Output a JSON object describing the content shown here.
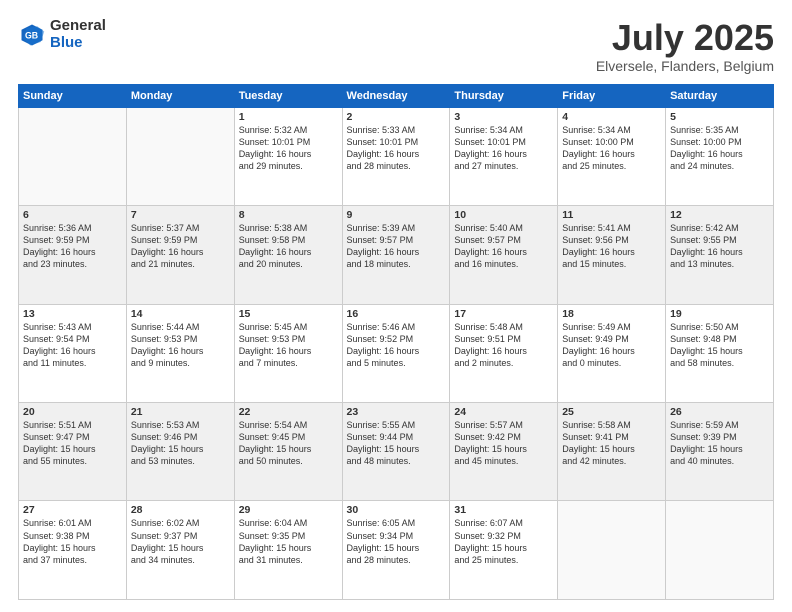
{
  "logo": {
    "general": "General",
    "blue": "Blue"
  },
  "header": {
    "month": "July 2025",
    "location": "Elversele, Flanders, Belgium"
  },
  "days_of_week": [
    "Sunday",
    "Monday",
    "Tuesday",
    "Wednesday",
    "Thursday",
    "Friday",
    "Saturday"
  ],
  "weeks": [
    [
      {
        "num": "",
        "info": ""
      },
      {
        "num": "",
        "info": ""
      },
      {
        "num": "1",
        "info": "Sunrise: 5:32 AM\nSunset: 10:01 PM\nDaylight: 16 hours\nand 29 minutes."
      },
      {
        "num": "2",
        "info": "Sunrise: 5:33 AM\nSunset: 10:01 PM\nDaylight: 16 hours\nand 28 minutes."
      },
      {
        "num": "3",
        "info": "Sunrise: 5:34 AM\nSunset: 10:01 PM\nDaylight: 16 hours\nand 27 minutes."
      },
      {
        "num": "4",
        "info": "Sunrise: 5:34 AM\nSunset: 10:00 PM\nDaylight: 16 hours\nand 25 minutes."
      },
      {
        "num": "5",
        "info": "Sunrise: 5:35 AM\nSunset: 10:00 PM\nDaylight: 16 hours\nand 24 minutes."
      }
    ],
    [
      {
        "num": "6",
        "info": "Sunrise: 5:36 AM\nSunset: 9:59 PM\nDaylight: 16 hours\nand 23 minutes."
      },
      {
        "num": "7",
        "info": "Sunrise: 5:37 AM\nSunset: 9:59 PM\nDaylight: 16 hours\nand 21 minutes."
      },
      {
        "num": "8",
        "info": "Sunrise: 5:38 AM\nSunset: 9:58 PM\nDaylight: 16 hours\nand 20 minutes."
      },
      {
        "num": "9",
        "info": "Sunrise: 5:39 AM\nSunset: 9:57 PM\nDaylight: 16 hours\nand 18 minutes."
      },
      {
        "num": "10",
        "info": "Sunrise: 5:40 AM\nSunset: 9:57 PM\nDaylight: 16 hours\nand 16 minutes."
      },
      {
        "num": "11",
        "info": "Sunrise: 5:41 AM\nSunset: 9:56 PM\nDaylight: 16 hours\nand 15 minutes."
      },
      {
        "num": "12",
        "info": "Sunrise: 5:42 AM\nSunset: 9:55 PM\nDaylight: 16 hours\nand 13 minutes."
      }
    ],
    [
      {
        "num": "13",
        "info": "Sunrise: 5:43 AM\nSunset: 9:54 PM\nDaylight: 16 hours\nand 11 minutes."
      },
      {
        "num": "14",
        "info": "Sunrise: 5:44 AM\nSunset: 9:53 PM\nDaylight: 16 hours\nand 9 minutes."
      },
      {
        "num": "15",
        "info": "Sunrise: 5:45 AM\nSunset: 9:53 PM\nDaylight: 16 hours\nand 7 minutes."
      },
      {
        "num": "16",
        "info": "Sunrise: 5:46 AM\nSunset: 9:52 PM\nDaylight: 16 hours\nand 5 minutes."
      },
      {
        "num": "17",
        "info": "Sunrise: 5:48 AM\nSunset: 9:51 PM\nDaylight: 16 hours\nand 2 minutes."
      },
      {
        "num": "18",
        "info": "Sunrise: 5:49 AM\nSunset: 9:49 PM\nDaylight: 16 hours\nand 0 minutes."
      },
      {
        "num": "19",
        "info": "Sunrise: 5:50 AM\nSunset: 9:48 PM\nDaylight: 15 hours\nand 58 minutes."
      }
    ],
    [
      {
        "num": "20",
        "info": "Sunrise: 5:51 AM\nSunset: 9:47 PM\nDaylight: 15 hours\nand 55 minutes."
      },
      {
        "num": "21",
        "info": "Sunrise: 5:53 AM\nSunset: 9:46 PM\nDaylight: 15 hours\nand 53 minutes."
      },
      {
        "num": "22",
        "info": "Sunrise: 5:54 AM\nSunset: 9:45 PM\nDaylight: 15 hours\nand 50 minutes."
      },
      {
        "num": "23",
        "info": "Sunrise: 5:55 AM\nSunset: 9:44 PM\nDaylight: 15 hours\nand 48 minutes."
      },
      {
        "num": "24",
        "info": "Sunrise: 5:57 AM\nSunset: 9:42 PM\nDaylight: 15 hours\nand 45 minutes."
      },
      {
        "num": "25",
        "info": "Sunrise: 5:58 AM\nSunset: 9:41 PM\nDaylight: 15 hours\nand 42 minutes."
      },
      {
        "num": "26",
        "info": "Sunrise: 5:59 AM\nSunset: 9:39 PM\nDaylight: 15 hours\nand 40 minutes."
      }
    ],
    [
      {
        "num": "27",
        "info": "Sunrise: 6:01 AM\nSunset: 9:38 PM\nDaylight: 15 hours\nand 37 minutes."
      },
      {
        "num": "28",
        "info": "Sunrise: 6:02 AM\nSunset: 9:37 PM\nDaylight: 15 hours\nand 34 minutes."
      },
      {
        "num": "29",
        "info": "Sunrise: 6:04 AM\nSunset: 9:35 PM\nDaylight: 15 hours\nand 31 minutes."
      },
      {
        "num": "30",
        "info": "Sunrise: 6:05 AM\nSunset: 9:34 PM\nDaylight: 15 hours\nand 28 minutes."
      },
      {
        "num": "31",
        "info": "Sunrise: 6:07 AM\nSunset: 9:32 PM\nDaylight: 15 hours\nand 25 minutes."
      },
      {
        "num": "",
        "info": ""
      },
      {
        "num": "",
        "info": ""
      }
    ]
  ]
}
